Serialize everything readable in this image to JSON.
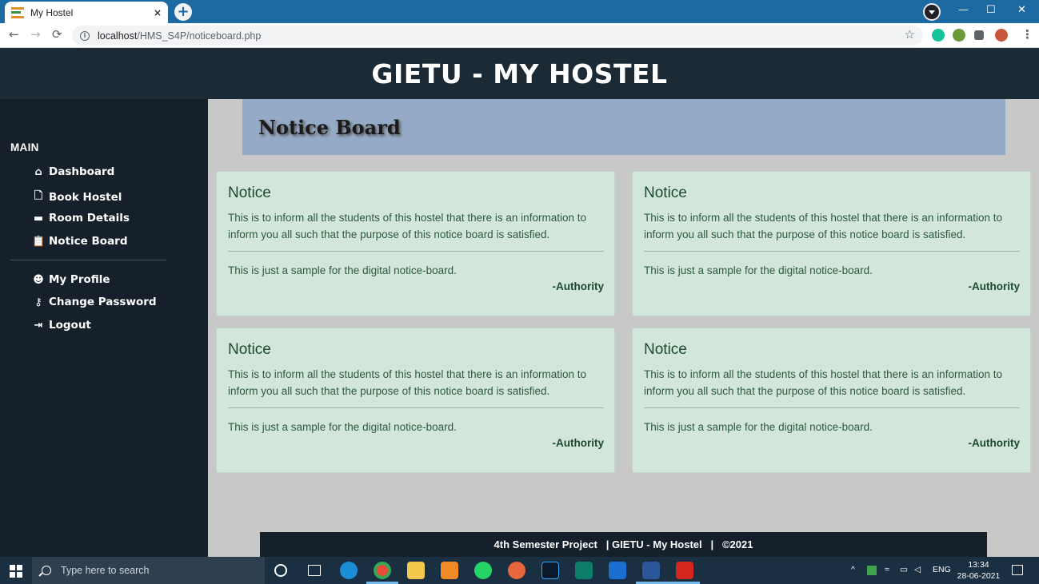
{
  "browser": {
    "tab_title": "My Hostel",
    "tab_close": "×",
    "new_tab": "+",
    "url_host": "localhost",
    "url_path": "/HMS_S4P/noticeboard.php",
    "window_controls": [
      "—",
      "☐",
      "✕"
    ]
  },
  "site": {
    "title": "GIETU - MY HOSTEL"
  },
  "sidebar": {
    "section_main": "MAIN",
    "main_items": [
      {
        "label": "Dashboard",
        "icon": "dashboard-icon"
      },
      {
        "label": "Book Hostel",
        "icon": "file-icon"
      },
      {
        "label": "Room Details",
        "icon": "bed-icon"
      },
      {
        "label": "Notice Board",
        "icon": "clipboard-icon"
      }
    ],
    "account_items": [
      {
        "label": "My Profile",
        "icon": "user-circle-icon"
      },
      {
        "label": "Change Password",
        "icon": "key-icon"
      },
      {
        "label": "Logout",
        "icon": "sign-out-icon"
      }
    ]
  },
  "notice_board": {
    "heading": "Notice Board",
    "notices": [
      {
        "title": "Notice",
        "body": "This is to inform all the students of this hostel that there is an information to inform you all such that the purpose of this notice board is satisfied.",
        "note": "This is just a sample for the digital notice-board.",
        "signature": "-Authority"
      },
      {
        "title": "Notice",
        "body": "This is to inform all the students of this hostel that there is an information to inform you all such that the purpose of this notice board is satisfied.",
        "note": "This is just a sample for the digital notice-board.",
        "signature": "-Authority"
      },
      {
        "title": "Notice",
        "body": "This is to inform all the students of this hostel that there is an information to inform you all such that the purpose of this notice board is satisfied.",
        "note": "This is just a sample for the digital notice-board.",
        "signature": "-Authority"
      },
      {
        "title": "Notice",
        "body": "This is to inform all the students of this hostel that there is an information to inform you all such that the purpose of this notice board is satisfied.",
        "note": "This is just a sample for the digital notice-board.",
        "signature": "-Authority"
      }
    ]
  },
  "footer": {
    "text": "4th Semester Project   | GIETU - My Hostel   |   ©2021"
  },
  "taskbar": {
    "search_placeholder": "Type here to search",
    "language": "ENG",
    "time": "13:34",
    "date": "28-06-2021"
  },
  "colors": {
    "header_bg": "#1b2a35",
    "sidebar_bg": "#16202a",
    "notice_header_bg": "#94aac6",
    "card_bg": "#d2e6dc",
    "page_bg": "#c8c8c8"
  }
}
